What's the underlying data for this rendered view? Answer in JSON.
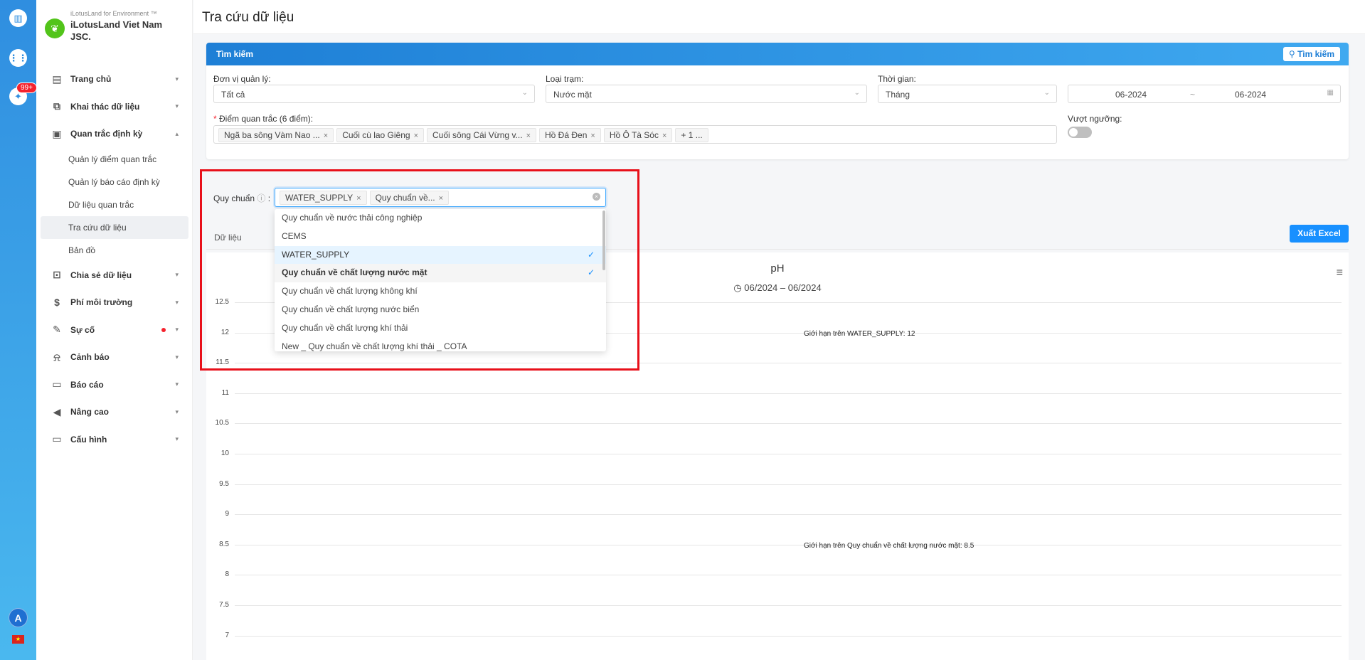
{
  "rail": {
    "badge": "99+",
    "avatar": "A"
  },
  "brand": {
    "small": "iLotusLand for Environment ™",
    "name": "iLotusLand Viet Nam JSC."
  },
  "menu": {
    "items": [
      "Trang chủ",
      "Khai thác dữ liệu",
      "Quan trắc định kỳ",
      "Chia sẻ dữ liệu",
      "Phí môi trường",
      "Sự cố",
      "Cảnh báo",
      "Báo cáo",
      "Nâng cao",
      "Cấu hình"
    ],
    "sub": [
      "Quản lý điểm quan trắc",
      "Quản lý báo cáo định kỳ",
      "Dữ liệu quan trắc",
      "Tra cứu dữ liệu",
      "Bản đồ"
    ]
  },
  "page": {
    "title": "Tra cứu dữ liệu"
  },
  "search": {
    "header": "Tìm kiếm",
    "button": "Tìm kiếm",
    "unit_label": "Đơn vị quản lý:",
    "unit_value": "Tất cả",
    "type_label": "Loại trạm:",
    "type_value": "Nước mặt",
    "time_label": "Thời gian:",
    "time_value": "Tháng",
    "date_from": "06-2024",
    "date_sep": "~",
    "date_to": "06-2024",
    "points_label": "Điểm quan trắc (6 điểm):",
    "points": [
      "Ngã ba sông Vàm Nao ...",
      "Cuối cù lao Giêng",
      "Cuối sông Cái Vừng v...",
      "Hồ Đá Đen",
      "Hồ Ô Tà Sóc"
    ],
    "points_more": "+ 1 ...",
    "exceed_label": "Vượt ngưỡng:"
  },
  "standard": {
    "label": "Quy chuẩn",
    "tags": [
      "WATER_SUPPLY",
      "Quy chuẩn về..."
    ],
    "options": [
      "Quy chuẩn về nước thải công nghiệp",
      "CEMS",
      "WATER_SUPPLY",
      "Quy chuẩn về chất lượng nước mặt",
      "Quy chuẩn về chất lượng không khí",
      "Quy chuẩn về chất lượng nước biển",
      "Quy chuẩn về chất lượng khí thải",
      "New _ Quy chuẩn về chất lượng khí thải _ COTA"
    ]
  },
  "tabs": {
    "data": "Dữ liệu"
  },
  "export_label": "Xuất Excel",
  "chart_data": {
    "type": "line",
    "title": "pH",
    "subtitle": "06/2024 – 06/2024",
    "y_ticks": [
      "12.5",
      "12",
      "11.5",
      "11",
      "10.5",
      "10",
      "9.5",
      "9",
      "8.5",
      "8",
      "7.5",
      "7"
    ],
    "ylim": [
      7,
      12.5
    ],
    "grid": true,
    "plot_lines": [
      {
        "label": "Giới hạn trên WATER_SUPPLY: 12",
        "value": 12
      },
      {
        "label": "Giới hạn trên Quy chuẩn về chất lượng nước mặt: 8.5",
        "value": 8.5
      }
    ]
  }
}
